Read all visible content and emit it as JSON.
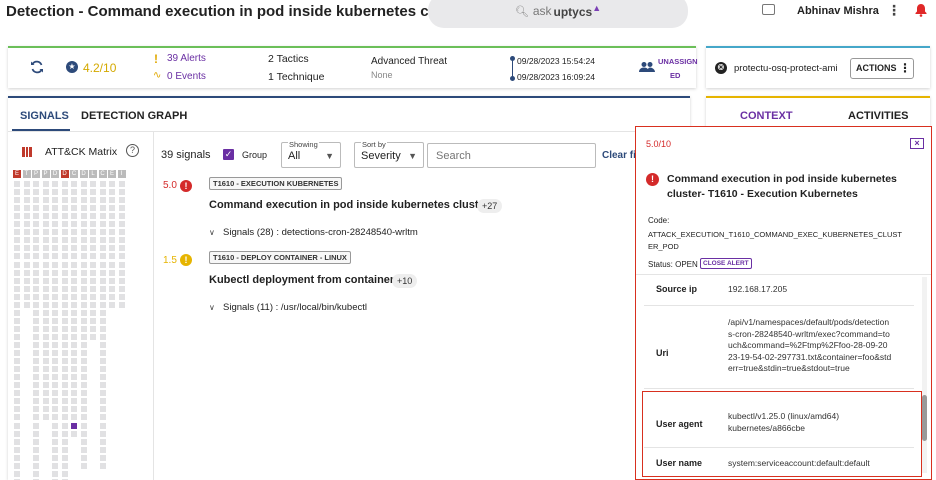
{
  "header": {
    "title": "Detection - Command execution in pod inside kubernetes cluster...",
    "search_prefix": "ask",
    "search_brand": "uptycs",
    "user_name": "Abhinav Mishra"
  },
  "summary": {
    "score": "4.2/10",
    "alerts": "39 Alerts",
    "events": "0 Events",
    "tactics": "2 Tactics",
    "techniques": "1 Technique",
    "threat_title": "Advanced Threat",
    "threat_value": "None",
    "time_start": "09/28/2023 15:54:24",
    "time_end": "09/28/2023 16:09:24",
    "assignee_line1": "UNASSIGN",
    "assignee_line2": "ED"
  },
  "asset": {
    "name": "protectu-osq-protect-ami",
    "actions_label": "ACTIONS"
  },
  "tabs": {
    "signals": "SIGNALS",
    "graph": "DETECTION GRAPH",
    "context": "CONTEXT",
    "activities": "ACTIVITIES"
  },
  "matrix": {
    "title": "ATT&CK Matrix",
    "letters": [
      "E",
      "T",
      "P",
      "P",
      "D",
      "D",
      "C",
      "D",
      "L",
      "C",
      "E",
      "I"
    ]
  },
  "filters": {
    "count": "39 signals",
    "group_label": "Group",
    "showing_label": "Showing",
    "showing_value": "All",
    "sort_label": "Sort by",
    "sort_value": "Severity",
    "search_placeholder": "Search",
    "clear": "Clear fi"
  },
  "signals": [
    {
      "score": "5.0",
      "tag": "T1610 - EXECUTION KUBERNETES",
      "title": "Command execution in pod inside kubernetes cluster",
      "count": "+27",
      "detail": "Signals (28) : detections-cron-28248540-wrltm"
    },
    {
      "score": "1.5",
      "tag": "T1610 - DEPLOY CONTAINER - LINUX",
      "title": "Kubectl deployment from container",
      "count": "+10",
      "detail": "Signals (11) : /usr/local/bin/kubectl"
    }
  ],
  "detail": {
    "score": "5.0/10",
    "title": "Command execution in pod inside kubernetes cluster- T1610 - Execution Kubernetes",
    "code_label": "Code:",
    "code_value": "ATTACK_EXECUTION_T1610_COMMAND_EXEC_KUBERNETES_CLUSTER_POD",
    "status_text": "Status: OPEN",
    "close_alert": "CLOSE ALERT",
    "rows": [
      {
        "key": "Source ip",
        "value": "192.168.17.205"
      },
      {
        "key": "Uri",
        "value": "/api/v1/namespaces/default/pods/detections-cron-28248540-wrltm/exec?command=touch&command=%2Ftmp%2Ffoo-28-09-2023-19-54-02-297731.txt&container=foo&stderr=true&stdin=true&stdout=true"
      },
      {
        "key": "User agent",
        "value": "kubectl/v1.25.0 (linux/amd64) kubernetes/a866cbe"
      },
      {
        "key": "User name",
        "value": "system:serviceaccount:default:default"
      }
    ]
  },
  "colors": {
    "accent": "#6a2fa3",
    "red": "#d42a2a",
    "gold": "#e6b400",
    "highlight": "#d8301f"
  }
}
